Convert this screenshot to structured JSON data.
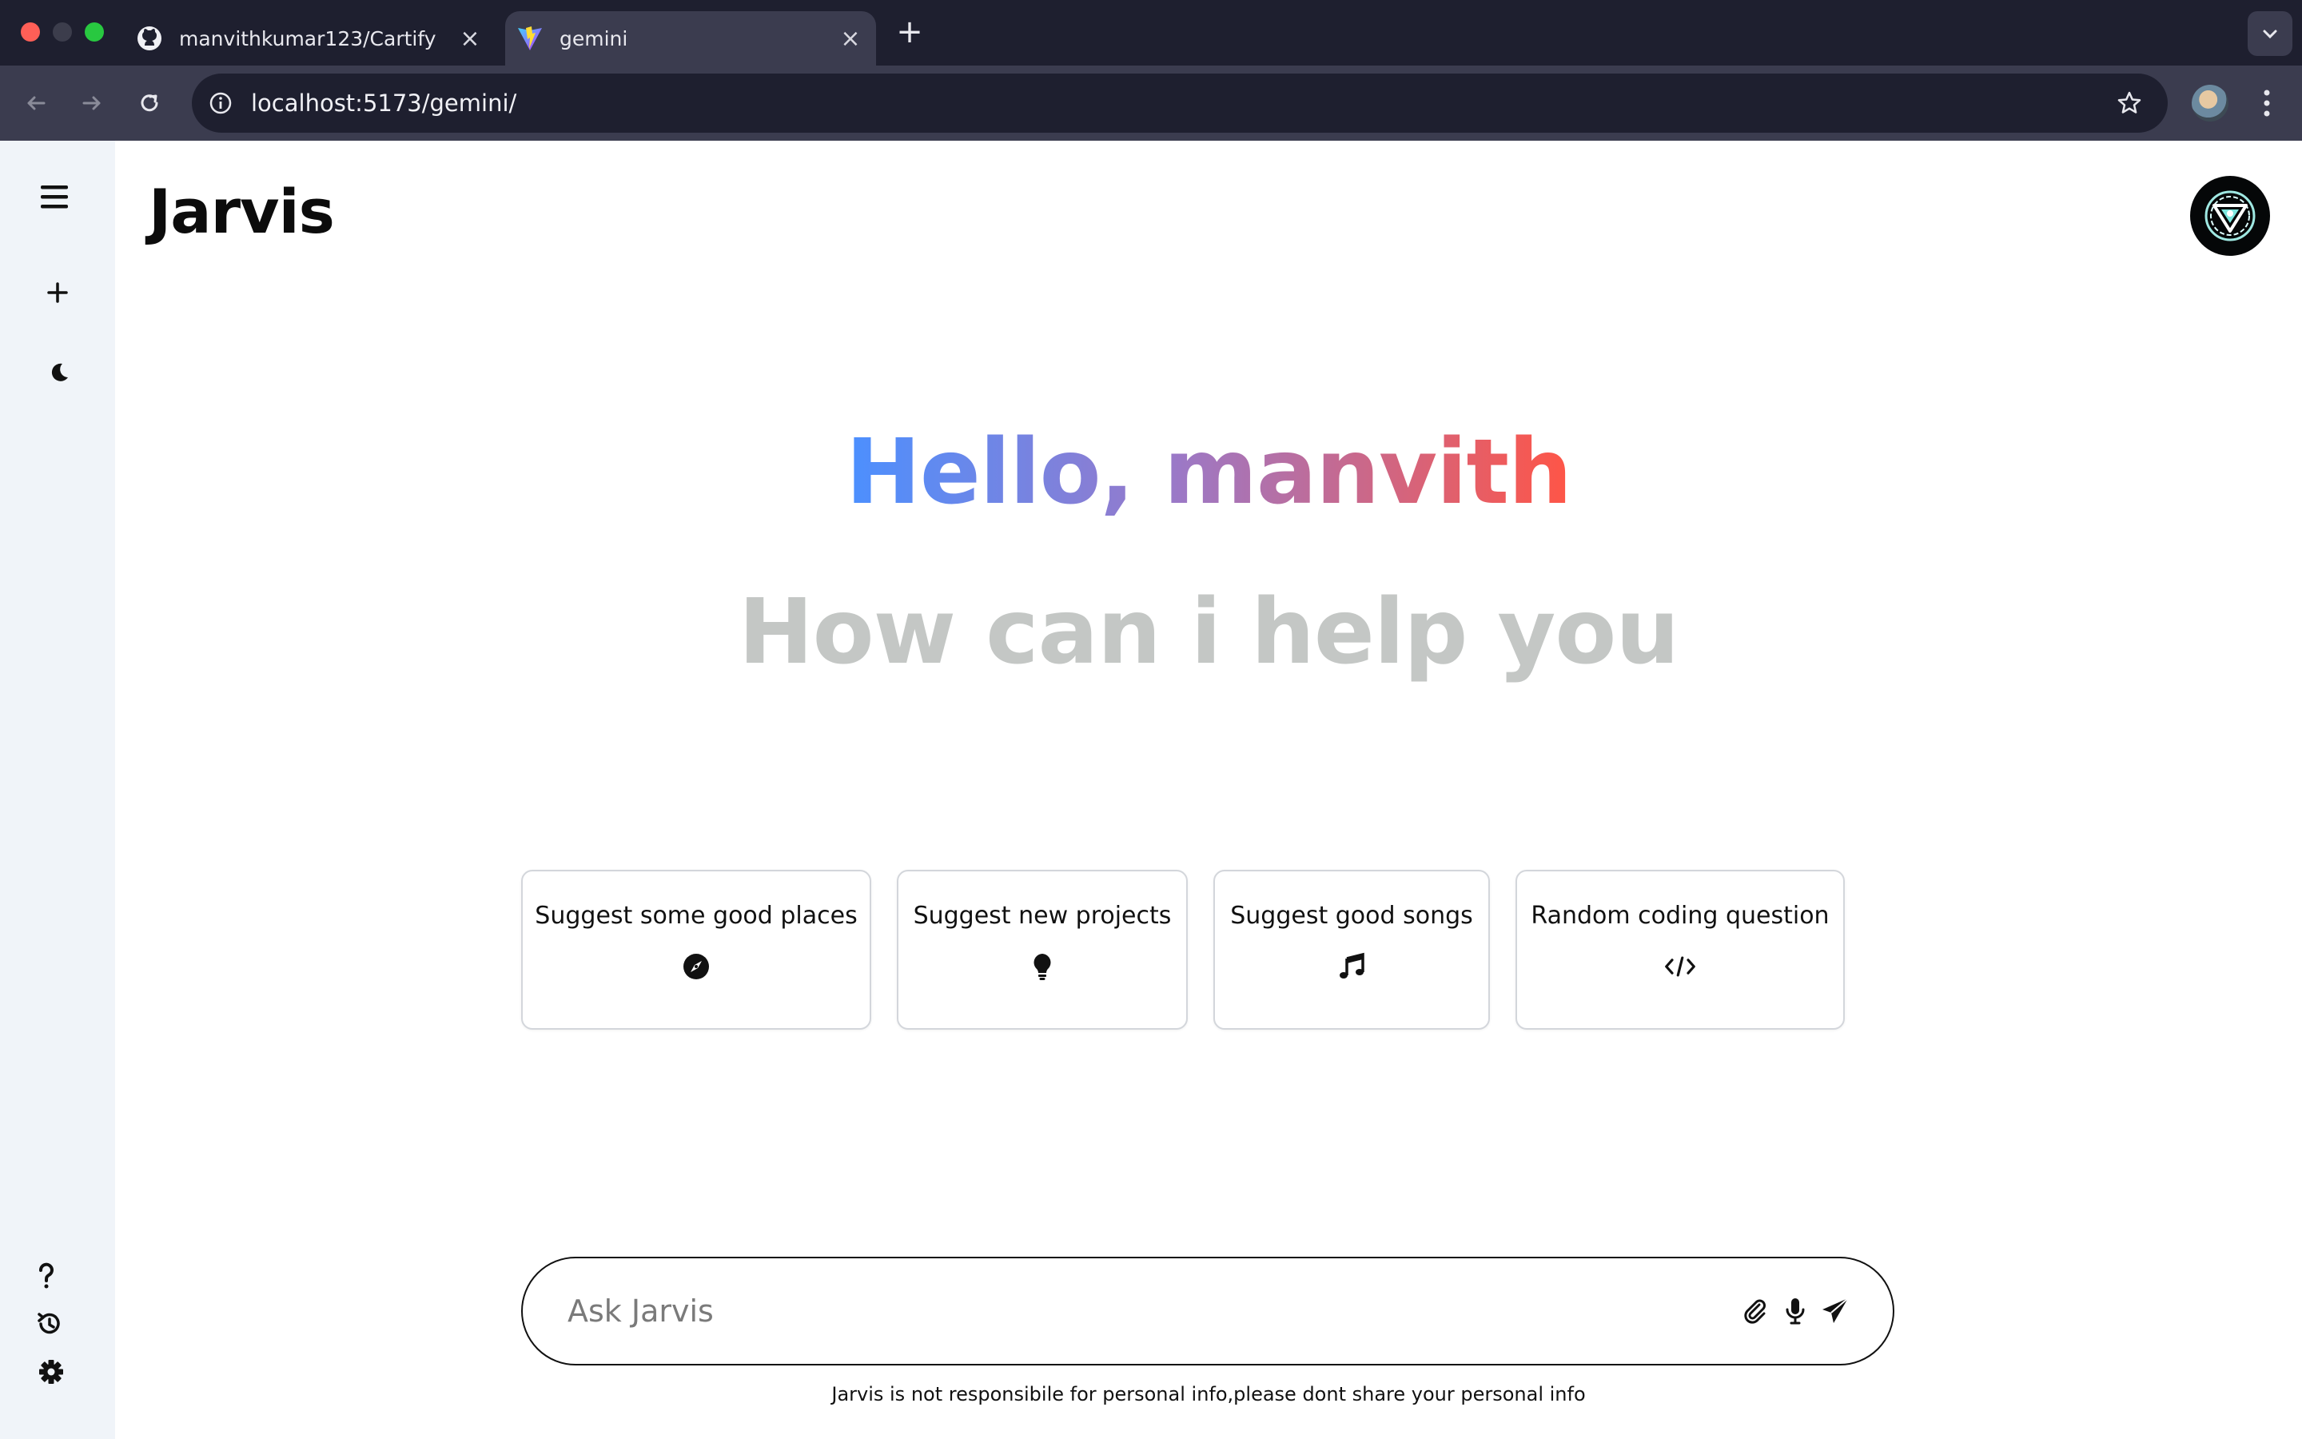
{
  "browser": {
    "tabs": [
      {
        "label": "manvithkumar123/Cartify",
        "icon": "github-icon",
        "active": false
      },
      {
        "label": "gemini",
        "icon": "vite-icon",
        "active": true
      }
    ],
    "url": "localhost:5173/gemini/"
  },
  "app": {
    "brand": "Jarvis",
    "greeting": "Hello, manvith",
    "subgreeting": "How can i help you",
    "cards": [
      {
        "label": "Suggest some good places",
        "icon": "compass-icon"
      },
      {
        "label": "Suggest new projects",
        "icon": "bulb-icon"
      },
      {
        "label": "Suggest good songs",
        "icon": "music-icon"
      },
      {
        "label": "Random coding question",
        "icon": "code-icon"
      }
    ],
    "search": {
      "placeholder": "Ask Jarvis",
      "value": ""
    },
    "disclaimer": "Jarvis is not responsibile for personal info,please dont share your personal info",
    "colors": {
      "gradient_start": "#4b90ff",
      "gradient_mid": "#9a79c8",
      "gradient_end": "#ff5546",
      "sidebar_bg": "#f0f4f9",
      "subtitle": "#c4c7c5"
    }
  }
}
